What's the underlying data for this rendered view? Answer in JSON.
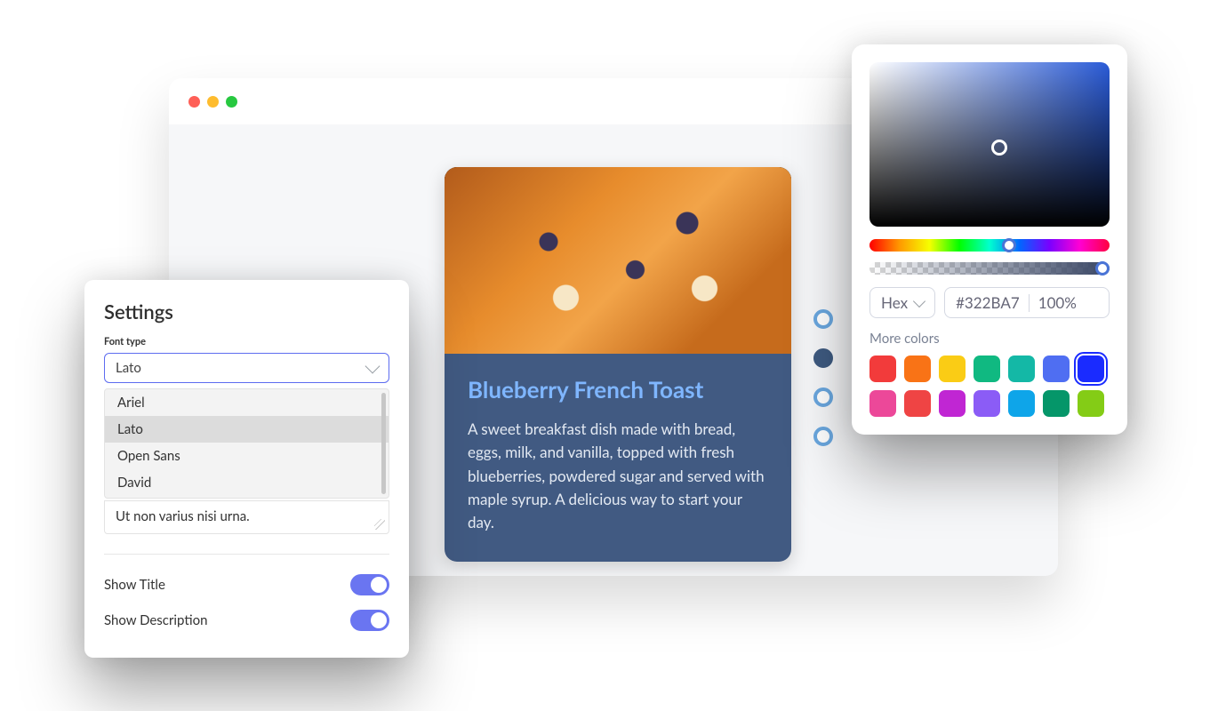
{
  "card": {
    "title": "Blueberry French Toast",
    "description": "A sweet breakfast dish made with bread, eggs, milk, and vanilla, topped with fresh blueberries, powdered sugar and served with maple syrup. A delicious way to start your day."
  },
  "pager": {
    "active_index": 1,
    "count": 4
  },
  "settings": {
    "title": "Settings",
    "font_type_label": "Font type",
    "font_selected": "Lato",
    "font_options": [
      "Ariel",
      "Lato",
      "Open Sans",
      "David"
    ],
    "sample_text": "Ut non varius nisi urna.",
    "show_title_label": "Show Title",
    "show_title_on": true,
    "show_description_label": "Show Description",
    "show_description_on": true
  },
  "picker": {
    "format_label": "Hex",
    "hex_value": "#322BA7",
    "opacity_value": "100%",
    "more_label": "More colors",
    "swatches_row1": [
      "#f23b3b",
      "#f97316",
      "#facc15",
      "#10b981",
      "#14b8a6",
      "#4f6ef2",
      "#1a2bff"
    ],
    "swatches_row2": [
      "#ec4899",
      "#ef4444",
      "#c026d3",
      "#8b5cf6",
      "#0ea5e9",
      "#059669",
      "#84cc16"
    ],
    "selected_swatch_index": 6
  }
}
